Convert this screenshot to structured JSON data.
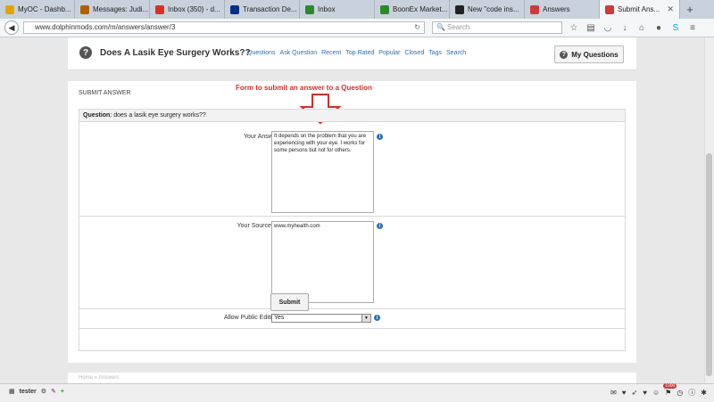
{
  "tabs": [
    {
      "label": "MyOC - Dashb...",
      "icon": "star-icon",
      "color": "#e4a400"
    },
    {
      "label": "Messages: Judi...",
      "icon": "mail-folder-icon",
      "color": "#b06000"
    },
    {
      "label": "Inbox (350) - d...",
      "icon": "gmail-icon",
      "color": "#d93025"
    },
    {
      "label": "Transaction De...",
      "icon": "paypal-icon",
      "color": "#003087"
    },
    {
      "label": "Inbox",
      "icon": "oo-icon",
      "color": "#2a8a2a"
    },
    {
      "label": "BoonEx Market...",
      "icon": "boonex-icon",
      "color": "#2a8a2a"
    },
    {
      "label": "New \"code ins...",
      "icon": "code-icon",
      "color": "#222222"
    },
    {
      "label": "Answers",
      "icon": "answers-icon",
      "color": "#d13a3a"
    },
    {
      "label": "Submit Ans...",
      "icon": "answers-icon",
      "color": "#d13a3a",
      "active": true
    }
  ],
  "url": "www.dolphinmods.com/m/answers/answer/3",
  "search_placeholder": "Search",
  "page": {
    "title": "Does A Lasik Eye Surgery Works??",
    "nav": [
      "Questions",
      "Ask Question",
      "Recent",
      "Top Rated",
      "Popular",
      "Closed",
      "Tags",
      "Search"
    ],
    "my_questions": "My Questions",
    "section_label": "Submit answer",
    "annotation": "Form to submit an answer to a Question",
    "question_label": "Question",
    "question_text": ": does a lasik eye surgery works??",
    "answer_label": "Your Answer:",
    "answer_value": "It depends on the problem that you are experiencing with your eye. I works for some persons but not for others.",
    "source_label": "Your Source(s):",
    "source_value": "www.myhealth.com",
    "editing_label": "Allow Public Editing:",
    "editing_value": "Yes",
    "submit_label": "Submit",
    "footer": "Home  »  Answers"
  },
  "bottom": {
    "user": "tester",
    "badge": "1000"
  },
  "colors": {
    "accent_link": "#2a6ebb",
    "annotation_red": "#d0302f"
  }
}
